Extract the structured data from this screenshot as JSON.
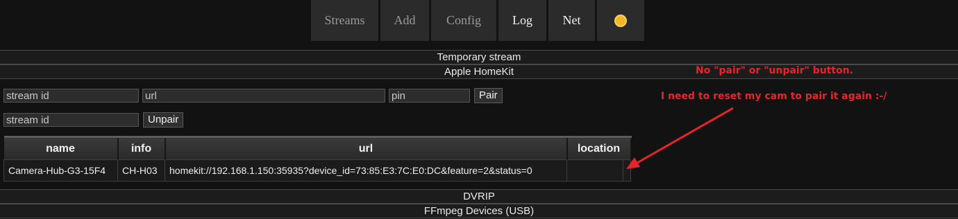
{
  "nav": {
    "tabs": [
      {
        "label": "Streams"
      },
      {
        "label": "Add"
      },
      {
        "label": "Config"
      },
      {
        "label": "Log"
      },
      {
        "label": "Net"
      }
    ],
    "theme_icon": "sun-icon"
  },
  "sections": {
    "temporary_stream": "Temporary stream",
    "homekit": "Apple HomeKit",
    "dvrip": "DVRIP",
    "ffmpeg_usb": "FFmpeg Devices (USB)"
  },
  "pair_form": {
    "stream_id_placeholder": "stream id",
    "url_placeholder": "url",
    "pin_placeholder": "pin",
    "pair_label": "Pair"
  },
  "unpair_form": {
    "stream_id_placeholder": "stream id",
    "unpair_label": "Unpair"
  },
  "table": {
    "headers": [
      "name",
      "info",
      "url",
      "location"
    ],
    "rows": [
      {
        "name": "Camera-Hub-G3-15F4",
        "info": "CH-H03",
        "url": "homekit://192.168.1.150:35935?device_id=73:85:E3:7C:E0:DC&feature=2&status=0",
        "location": ""
      }
    ]
  },
  "annotation": {
    "line1": "No \"pair\" or \"unpair\" button.",
    "line2": "I need to reset my cam to pair it again :-/",
    "color": "#e8242a"
  }
}
